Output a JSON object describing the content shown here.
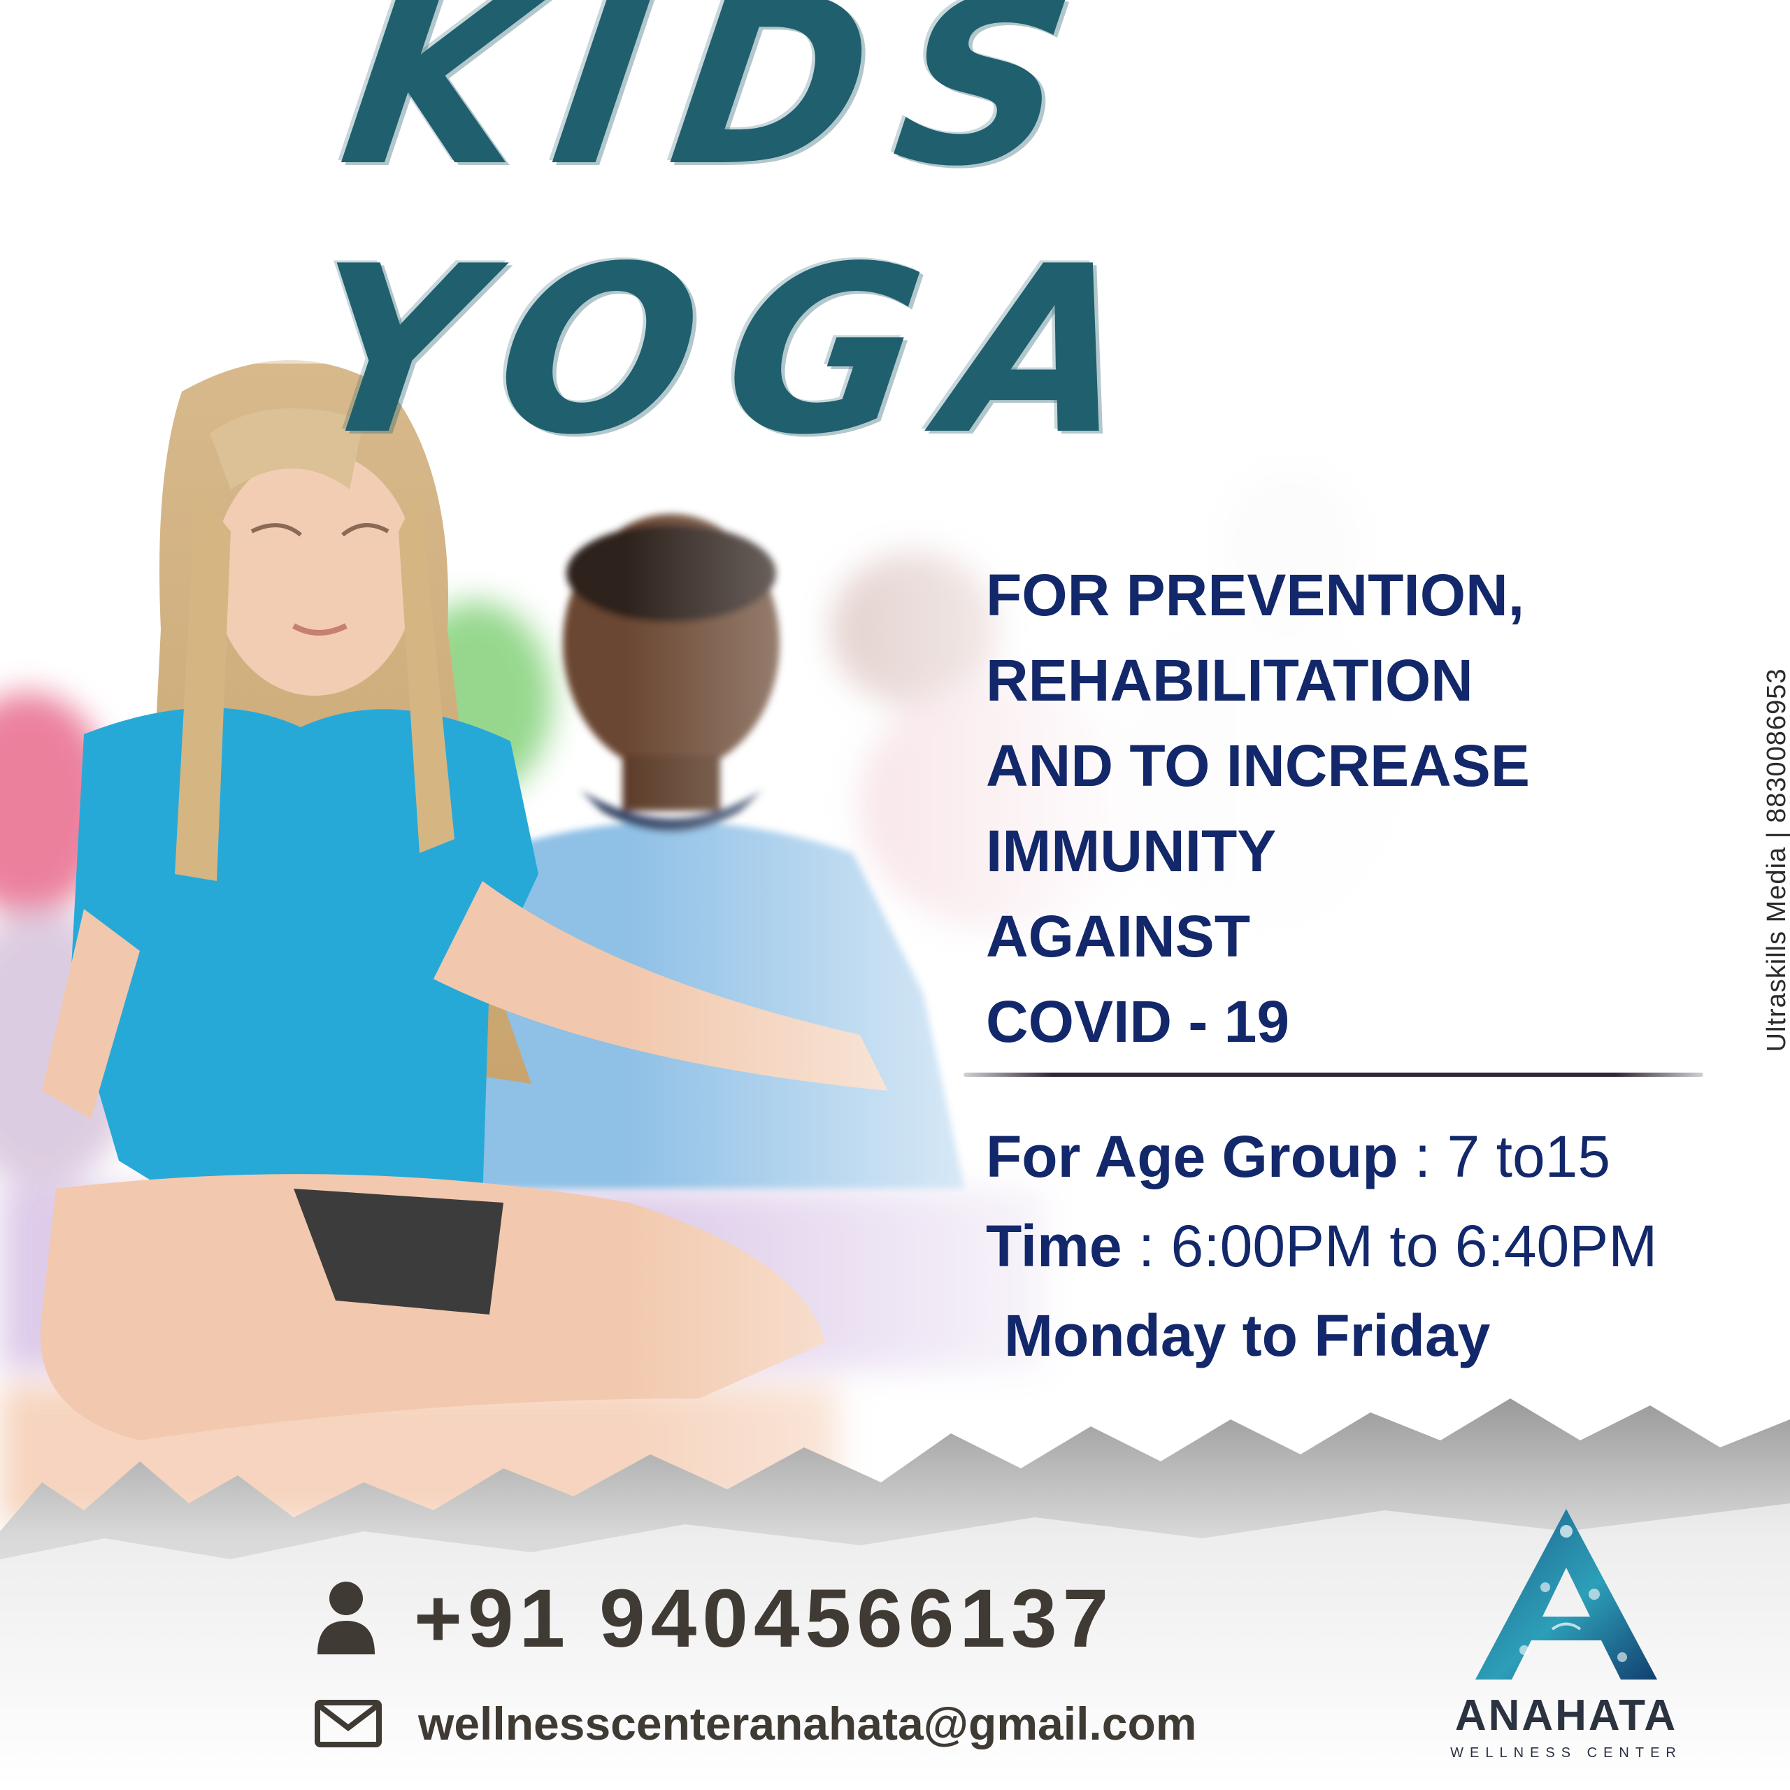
{
  "headline": "KIDS YOGA",
  "purpose_lines": [
    "FOR PREVENTION,",
    "REHABILITATION",
    "AND TO INCREASE",
    "IMMUNITY",
    "AGAINST",
    "COVID - 19"
  ],
  "details": {
    "age_label": "For Age Group",
    "age_value": " : 7 to15",
    "time_label": "Time",
    "time_value": " : 6:00PM to 6:40PM",
    "days": "Monday to Friday"
  },
  "credit": "Ultraskills Media | 8830086953",
  "contact": {
    "phone": "+91 9404566137",
    "email": "wellnesscenteranahata@gmail.com",
    "phone_icon": "person-icon",
    "email_icon": "envelope-icon"
  },
  "brand": {
    "name": "ANAHATA",
    "tagline": "WELLNESS CENTER"
  },
  "colors": {
    "headline": "#1f5f6e",
    "body_text": "#13286a",
    "contact_text": "#3f3a33"
  }
}
